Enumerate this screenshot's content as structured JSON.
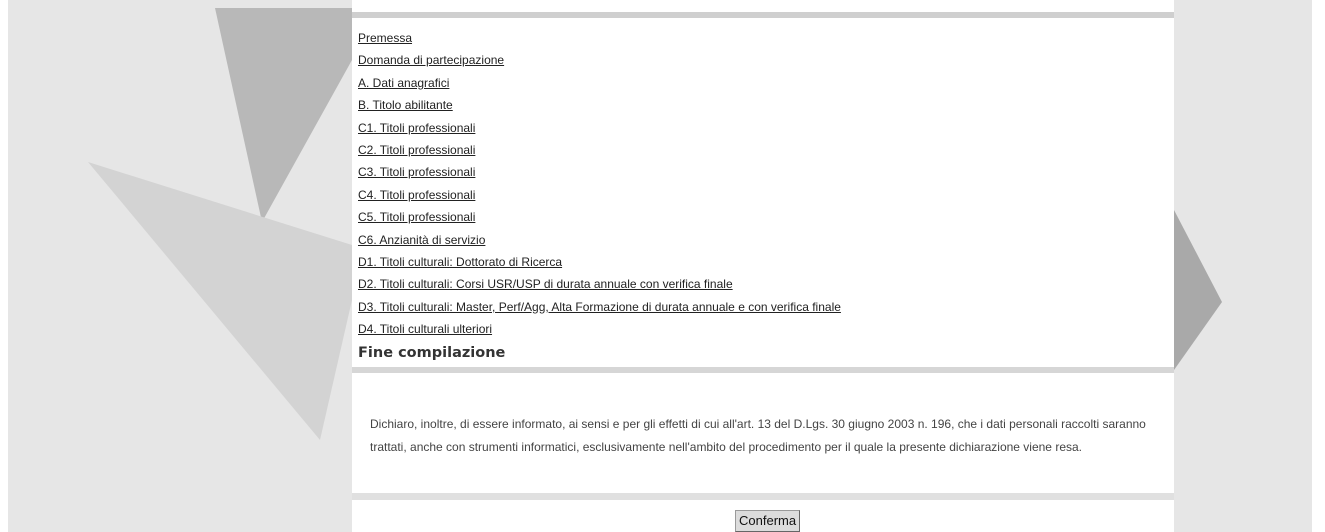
{
  "menu": {
    "items": [
      {
        "label": "Premessa"
      },
      {
        "label": "Domanda di partecipazione"
      },
      {
        "label": "A. Dati anagrafici"
      },
      {
        "label": "B. Titolo abilitante"
      },
      {
        "label": "C1. Titoli professionali"
      },
      {
        "label": "C2. Titoli professionali"
      },
      {
        "label": "C3. Titoli professionali"
      },
      {
        "label": "C4. Titoli professionali"
      },
      {
        "label": "C5. Titoli professionali"
      },
      {
        "label": "C6. Anzianità di servizio"
      },
      {
        "label": "D1. Titoli culturali: Dottorato di Ricerca"
      },
      {
        "label": "D2. Titoli culturali: Corsi USR/USP di durata annuale con verifica finale"
      },
      {
        "label": "D3. Titoli culturali: Master, Perf/Agg, Alta Formazione di durata annuale e con verifica finale"
      },
      {
        "label": "D4. Titoli culturali ulteriori"
      }
    ],
    "final_label": "Fine compilazione"
  },
  "declaration": {
    "text": "Dichiaro, inoltre, di essere informato, ai sensi e per gli effetti di cui all'art. 13 del D.Lgs. 30 giugno 2003 n. 196, che i dati personali raccolti saranno trattati, anche con strumenti informatici, esclusivamente nell'ambito del procedimento per il quale la presente dichiarazione viene resa."
  },
  "confirm": {
    "label": "Conferma"
  },
  "colors": {
    "page_background": "#e6e6e6",
    "panel": "#ffffff",
    "decor_dark": "#a8a8a8",
    "decor_light": "#d2d2d2"
  }
}
